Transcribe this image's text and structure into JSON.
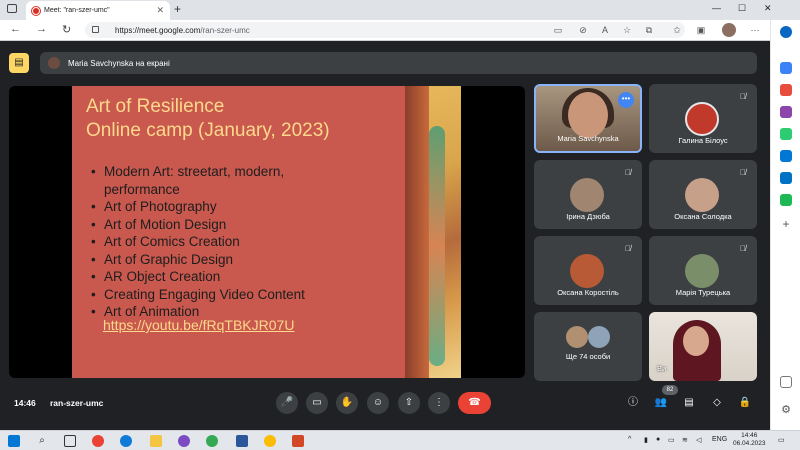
{
  "browser": {
    "tab_title": "Meet: \"ran-szer-umc\"",
    "url_host": "https://meet.google.com",
    "url_path": "/ran-szer-umc"
  },
  "presenting": {
    "banner_text": "Maria Savchynska на екрані"
  },
  "slide": {
    "title_line1": "Art of Resilience",
    "title_line2": "Online camp (January, 2023)",
    "bullets": [
      "Modern Art: streetart, modern, performance",
      "Art of Photography",
      "Art of Motion Design",
      "Art of Comics Creation",
      "Art of Graphic Design",
      "AR Object Creation",
      "Creating Engaging Video Content",
      "Art of Animation"
    ],
    "link": "https://youtu.be/fRqTBKJR07U"
  },
  "participants": [
    {
      "name": "Maria Savchynska"
    },
    {
      "name": "Галина Білоус"
    },
    {
      "name": "Ірина Дзюба"
    },
    {
      "name": "Оксана Солодка"
    },
    {
      "name": "Оксана Коростіль"
    },
    {
      "name": "Марія Турецька"
    },
    {
      "name": "Ще 74 особи"
    },
    {
      "name": "Ви"
    }
  ],
  "controls": {
    "time": "14:46",
    "meeting_code": "ran-szer-umc",
    "people_count": "82"
  },
  "taskbar": {
    "lang": "ENG",
    "time": "14:46",
    "date": "06.04.2023"
  },
  "colors": {
    "slide_bg": "#c9594f",
    "slide_title": "#fdd98b",
    "end_call": "#ea4335",
    "active_speaker_border": "#8ab4f8"
  }
}
